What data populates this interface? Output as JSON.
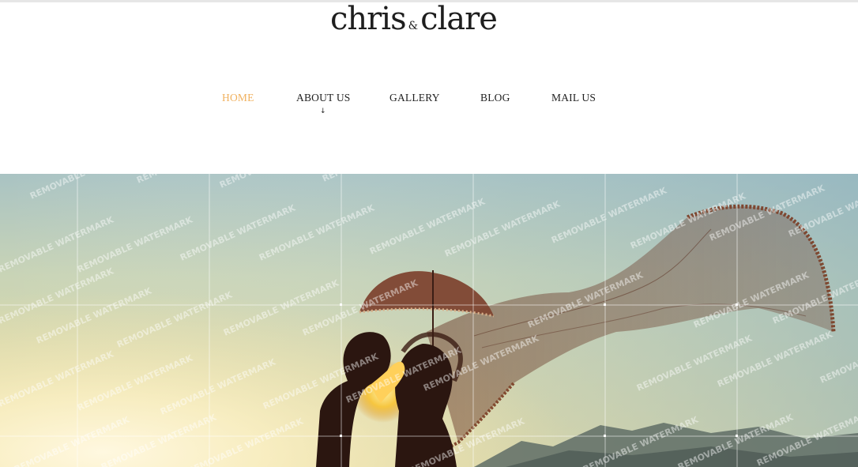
{
  "logo": {
    "word1": "chris",
    "amp": "&",
    "word2": "clare"
  },
  "nav": {
    "items": [
      {
        "label": "HOME",
        "active": true
      },
      {
        "label": "ABOUT US",
        "has_submenu": true
      },
      {
        "label": "GALLERY"
      },
      {
        "label": "BLOG"
      },
      {
        "label": "MAIL US"
      }
    ],
    "submenu_arrow": "↓"
  },
  "hero": {
    "watermark_text": "REMOVABLE WATERMARK",
    "description_icon": "couple-silhouette-with-veil-and-umbrella"
  },
  "colors": {
    "accent": "#f0b15f",
    "text": "#222222"
  }
}
